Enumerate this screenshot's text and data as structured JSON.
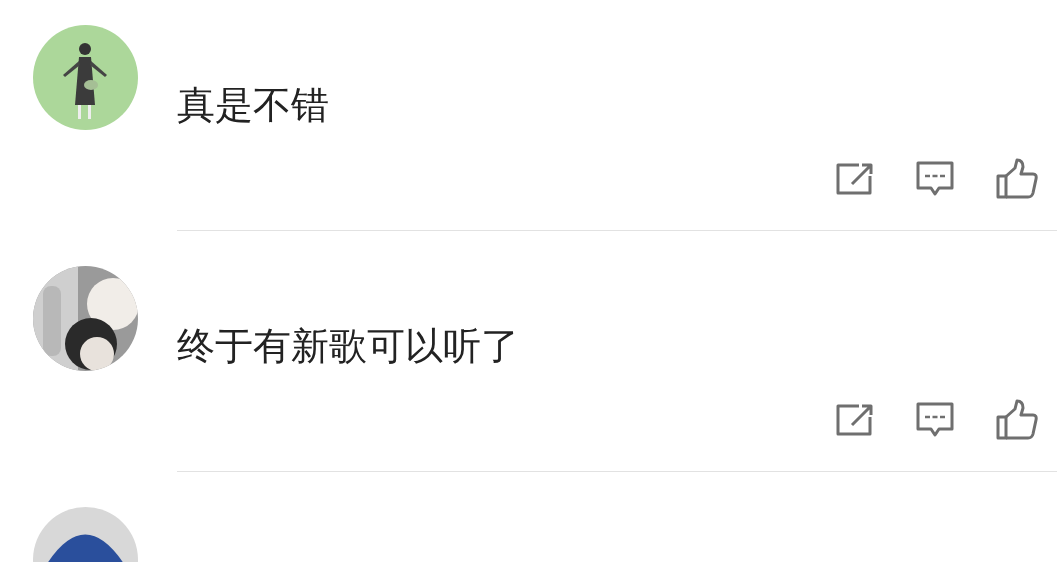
{
  "comments": [
    {
      "avatar": {
        "kind": "picture"
      },
      "text": "真是不错"
    },
    {
      "avatar": {
        "kind": "picture"
      },
      "text": "终于有新歌可以听了"
    },
    {
      "avatar": {
        "kind": "picture"
      }
    }
  ]
}
